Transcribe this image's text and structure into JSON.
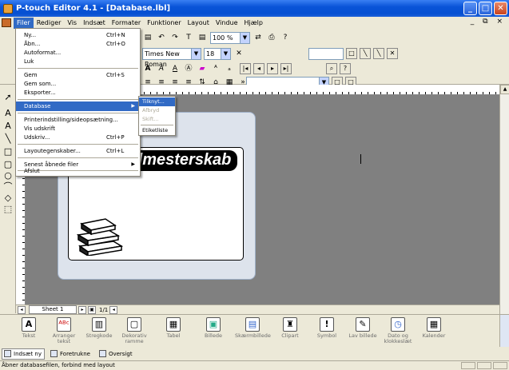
{
  "window": {
    "title": "P-touch Editor 4.1 - [Database.lbl]",
    "buttons": {
      "minimize": "_",
      "maximize": "□",
      "close": "✕"
    },
    "mdi_buttons": "_ ⧉ ×"
  },
  "menubar": {
    "items": [
      "Filer",
      "Rediger",
      "Vis",
      "Indsæt",
      "Formater",
      "Funktioner",
      "Layout",
      "Vindue",
      "Hjælp"
    ]
  },
  "toolbar": {
    "font_name": "Times New Roman",
    "font_size": "18",
    "zoom": "100 %",
    "glyphs": {
      "undo": "↶",
      "redo": "↷",
      "text": "T",
      "bold_a": "A",
      "italic_a": "A",
      "underline_a": "A",
      "bullet": "»"
    }
  },
  "file_menu": {
    "items": [
      {
        "label": "Ny...",
        "shortcut": "Ctrl+N"
      },
      {
        "label": "Åbn...",
        "shortcut": "Ctrl+O"
      },
      {
        "label": "Autoformat...",
        "shortcut": ""
      },
      {
        "label": "Luk",
        "shortcut": ""
      },
      {
        "label": "Gem",
        "shortcut": "Ctrl+S"
      },
      {
        "label": "Gem som...",
        "shortcut": ""
      },
      {
        "label": "Eksporter...",
        "shortcut": ""
      },
      {
        "label": "Database",
        "shortcut": ""
      },
      {
        "label": "Printerindstilling/sideopsætning...",
        "shortcut": ""
      },
      {
        "label": "Vis udskrift",
        "shortcut": ""
      },
      {
        "label": "Udskriv...",
        "shortcut": "Ctrl+P"
      },
      {
        "label": "Layoutegenskaber...",
        "shortcut": "Ctrl+L"
      },
      {
        "label": "Senest åbnede filer",
        "shortcut": ""
      },
      {
        "label": "Afslut",
        "shortcut": ""
      }
    ],
    "submenu_arrow": "▶"
  },
  "database_submenu": {
    "items": [
      "Tilknyt...",
      "Afbryd",
      "Skift...",
      "Etiketliste"
    ]
  },
  "canvas": {
    "label_text": "dmesterskab"
  },
  "sheet": {
    "tab": "Sheet 1",
    "page": "1/1"
  },
  "palette": {
    "items": [
      {
        "label": "Tekst",
        "icon": "A"
      },
      {
        "label": "Arranger tekst",
        "icon": "ᴬᴮᶜ"
      },
      {
        "label": "Stregkode",
        "icon": "▥"
      },
      {
        "label": "Dekorativ ramme",
        "icon": "▢"
      },
      {
        "label": "Tabel",
        "icon": "▦"
      },
      {
        "label": "Billede",
        "icon": "▣"
      },
      {
        "label": "Skærmbillede",
        "icon": "▤"
      },
      {
        "label": "Clipart",
        "icon": "♜"
      },
      {
        "label": "Symbol",
        "icon": "!"
      },
      {
        "label": "Lav billede",
        "icon": "✎"
      },
      {
        "label": "Dato og klokkeslæt",
        "icon": "◷"
      },
      {
        "label": "Kalender",
        "icon": "▦"
      }
    ]
  },
  "palette_tabs": [
    "Indsæt ny",
    "Foretrukne",
    "Oversigt"
  ],
  "statusbar": {
    "text": "Åbner databasefilen, forbind med layout"
  }
}
